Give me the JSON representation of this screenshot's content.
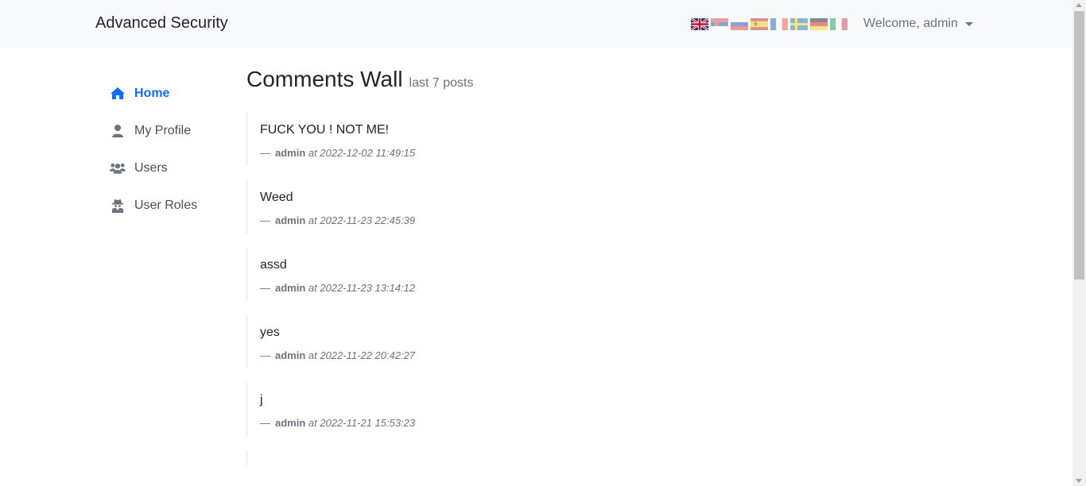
{
  "navbar": {
    "brand": "Advanced Security",
    "flags": [
      {
        "icon": "flag-uk-icon",
        "lang": "en",
        "active": true
      },
      {
        "icon": "flag-serbia-icon",
        "lang": "sr",
        "active": false
      },
      {
        "icon": "flag-russia-icon",
        "lang": "ru",
        "active": false
      },
      {
        "icon": "flag-spain-icon",
        "lang": "es",
        "active": false
      },
      {
        "icon": "flag-france-icon",
        "lang": "fr",
        "active": false
      },
      {
        "icon": "flag-sweden-icon",
        "lang": "sv",
        "active": false
      },
      {
        "icon": "flag-germany-icon",
        "lang": "de",
        "active": false
      },
      {
        "icon": "flag-italy-icon",
        "lang": "it",
        "active": false
      }
    ],
    "welcome": "Welcome, admin"
  },
  "sidebar": {
    "items": [
      {
        "label": "Home",
        "icon": "home-icon",
        "active": true
      },
      {
        "label": "My Profile",
        "icon": "user-icon",
        "active": false
      },
      {
        "label": "Users",
        "icon": "users-icon",
        "active": false
      },
      {
        "label": "User Roles",
        "icon": "user-secret-icon",
        "active": false
      }
    ]
  },
  "main": {
    "title": "Comments Wall",
    "subtitle": "last 7 posts",
    "posts": [
      {
        "text": "FUCK YOU ! NOT ME!",
        "dash": "—",
        "author": "admin",
        "at": "at",
        "date": "2022-12-02 11:49:15"
      },
      {
        "text": "Weed",
        "dash": "—",
        "author": "admin",
        "at": "at",
        "date": "2022-11-23 22:45:39"
      },
      {
        "text": "assd",
        "dash": "—",
        "author": "admin",
        "at": "at",
        "date": "2022-11-23 13:14:12"
      },
      {
        "text": "yes",
        "dash": "—",
        "author": "admin",
        "at": "at",
        "date": "2022-11-22 20:42:27"
      },
      {
        "text": "j",
        "dash": "—",
        "author": "admin",
        "at": "at",
        "date": "2022-11-21 15:53:23"
      }
    ]
  },
  "colors": {
    "accent": "#0d6efd",
    "navbar_bg": "#f8f9fa",
    "muted": "#6c757d"
  }
}
